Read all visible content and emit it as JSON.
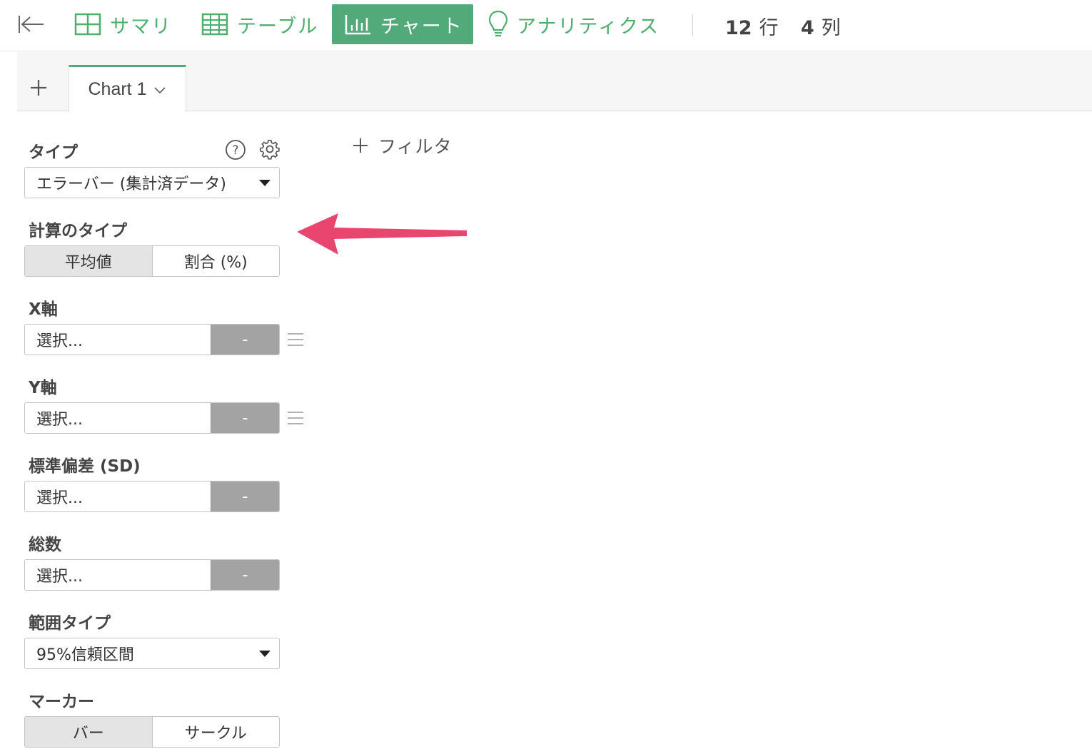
{
  "toolbar": {
    "nav": [
      {
        "label": "サマリ",
        "icon": "summary-grid-icon"
      },
      {
        "label": "テーブル",
        "icon": "table-icon"
      },
      {
        "label": "チャート",
        "icon": "bar-chart-icon",
        "active": true
      },
      {
        "label": "アナリティクス",
        "icon": "lightbulb-icon"
      }
    ],
    "rows": {
      "value": "12",
      "unit": "行"
    },
    "cols": {
      "value": "4",
      "unit": "列"
    }
  },
  "tabs": [
    {
      "label": "Chart 1",
      "active": true
    }
  ],
  "panel": {
    "type": {
      "label": "タイプ",
      "value": "エラーバー (集計済データ)"
    },
    "calc": {
      "label": "計算のタイプ",
      "options": [
        "平均値",
        "割合 (%)"
      ],
      "selected": 0
    },
    "x_axis": {
      "label": "X軸",
      "placeholder": "選択...",
      "agg": "-"
    },
    "y_axis": {
      "label": "Y軸",
      "placeholder": "選択...",
      "agg": "-"
    },
    "sd": {
      "label": "標準偏差 (SD)",
      "placeholder": "選択...",
      "agg": "-"
    },
    "count": {
      "label": "総数",
      "placeholder": "選択...",
      "agg": "-"
    },
    "range_type": {
      "label": "範囲タイプ",
      "value": "95%信頼区間"
    },
    "marker": {
      "label": "マーカー",
      "options": [
        "バー",
        "サークル"
      ],
      "selected": 0
    }
  },
  "filter": {
    "label": "フィルタ"
  },
  "colors": {
    "accent": "#52a97a",
    "accent_text": "#4caf6e",
    "annotation_arrow": "#e8456f",
    "agg_button": "#a3a3a3"
  }
}
